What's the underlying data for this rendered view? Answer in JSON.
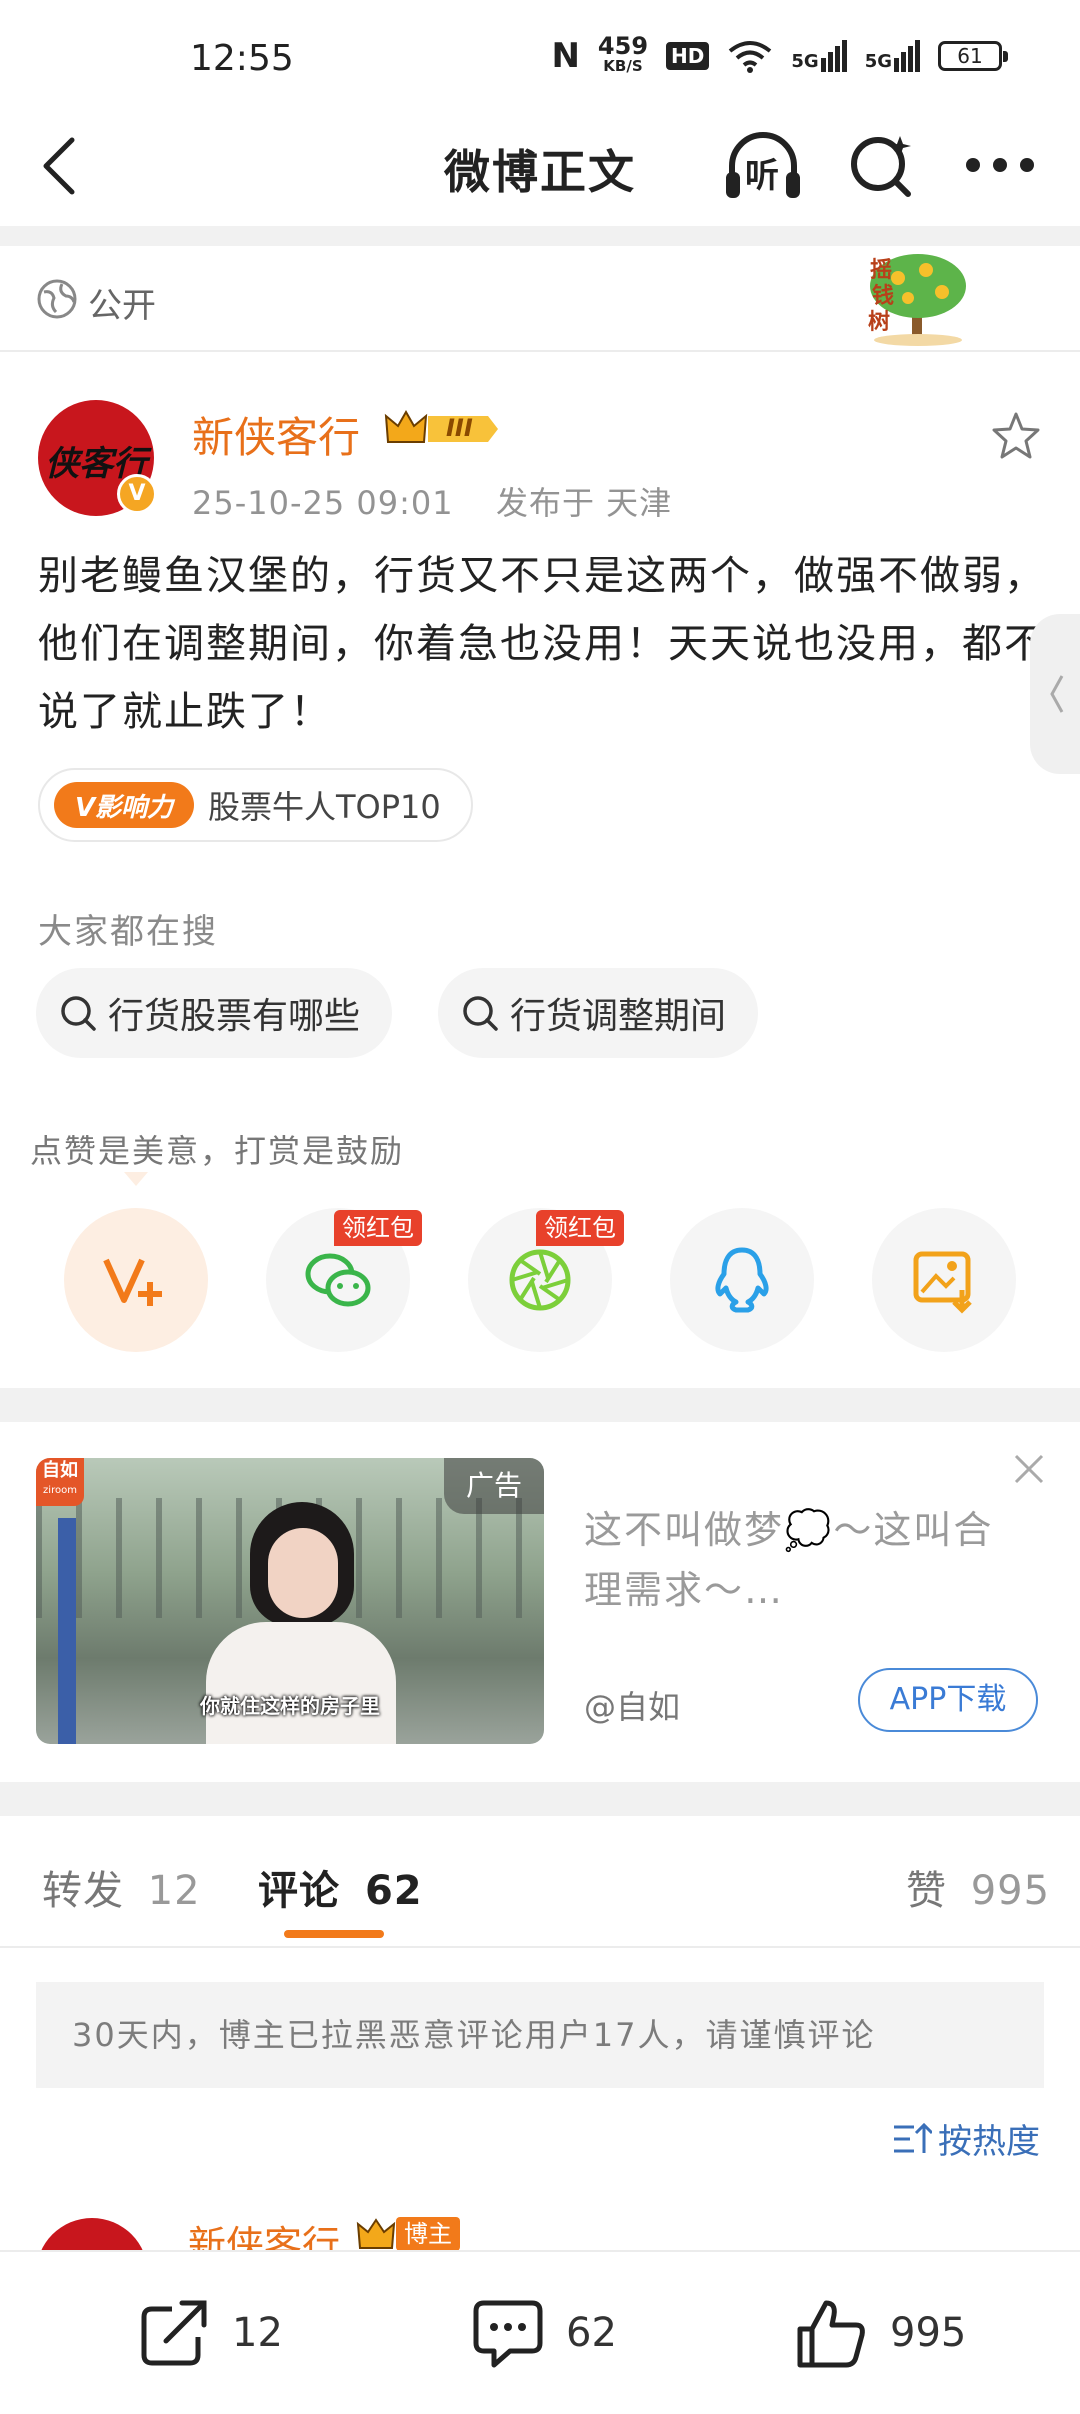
{
  "status_bar": {
    "time": "12:55",
    "net_speed_value": "459",
    "net_speed_unit": "KB/S",
    "hd_label": "HD",
    "signal_label_1": "5G",
    "signal_label_2": "5G",
    "battery": "61"
  },
  "header": {
    "title": "微博正文",
    "listen_label": "听"
  },
  "visibility": {
    "label": "公开",
    "tree_label_1": "摇",
    "tree_label_2": "钱",
    "tree_label_3": "树"
  },
  "post": {
    "avatar_text": "侠客行",
    "author": "新侠客行",
    "level_badge": "III",
    "date": "25-10-25 09:01",
    "location": "发布于 天津",
    "body": "别老鳗鱼汉堡的，行货又不只是这两个，做强不做弱，他们在调整期间，你着急也没用！天天说也没用，都不说了就止跌了！",
    "influence_tag": "V影响力",
    "influence_text": "股票牛人TOP10"
  },
  "search": {
    "label": "大家都在搜",
    "chips": [
      "行货股票有哪些",
      "行货调整期间"
    ]
  },
  "share": {
    "label": "点赞是美意，打赏是鼓励",
    "red_badge_1": "领红包",
    "red_badge_2": "领红包"
  },
  "ad": {
    "tag": "广告",
    "logo": "自如",
    "logo_sub": "ziroom",
    "caption": "你就住这样的房子里",
    "text": "这不叫做梦💭～这叫合理需求～…",
    "brand": "@自如",
    "button": "APP下载"
  },
  "tabs": {
    "repost_label": "转发",
    "repost_count": "12",
    "comment_label": "评论",
    "comment_count": "62",
    "like_label": "赞",
    "like_count": "995"
  },
  "notice": "30天内，博主已拉黑恶意评论用户17人，请谨慎评论",
  "sort_label": "按热度",
  "first_comment": {
    "author": "新侠客行",
    "badge": "博主"
  },
  "bottom_bar": {
    "repost": "12",
    "comment": "62",
    "like": "995"
  },
  "colors": {
    "accent_orange": "#e8701a",
    "tab_indicator": "#f27a1a",
    "link_blue": "#3a7bd5",
    "red_badge": "#e8412b"
  }
}
